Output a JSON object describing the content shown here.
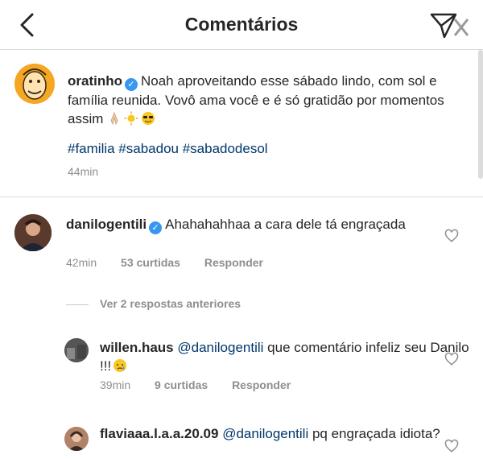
{
  "header": {
    "title": "Comentários"
  },
  "caption": {
    "username": "oratinho",
    "verified": true,
    "text": "Noah aproveitando esse sábado lindo, com sol e família reunida. Vovô ama você e é só gratidão por momentos assim",
    "hashtags": "#familia #sabadou #sabadodesol",
    "time": "44min"
  },
  "comments": [
    {
      "username": "danilogentili",
      "verified": true,
      "text": "Ahahahahhaa a cara dele tá engraçada",
      "time": "42min",
      "likes": "53 curtidas",
      "reply_label": "Responder"
    },
    {
      "username": "willen.haus",
      "mention": "@danilogentili",
      "text": "que comentário infeliz seu Danilo !!!",
      "time": "39min",
      "likes": "9 curtidas",
      "reply_label": "Responder"
    },
    {
      "username": "flaviaaa.l.a.a.20.09",
      "mention": "@danilogentili",
      "text": "pq engraçada idiota?"
    }
  ],
  "view_replies": "Ver 2 respostas anteriores",
  "colors": {
    "link": "#00376b",
    "verified": "#3897f0",
    "muted": "#8e8e8e",
    "divider": "#dbdbdb"
  }
}
